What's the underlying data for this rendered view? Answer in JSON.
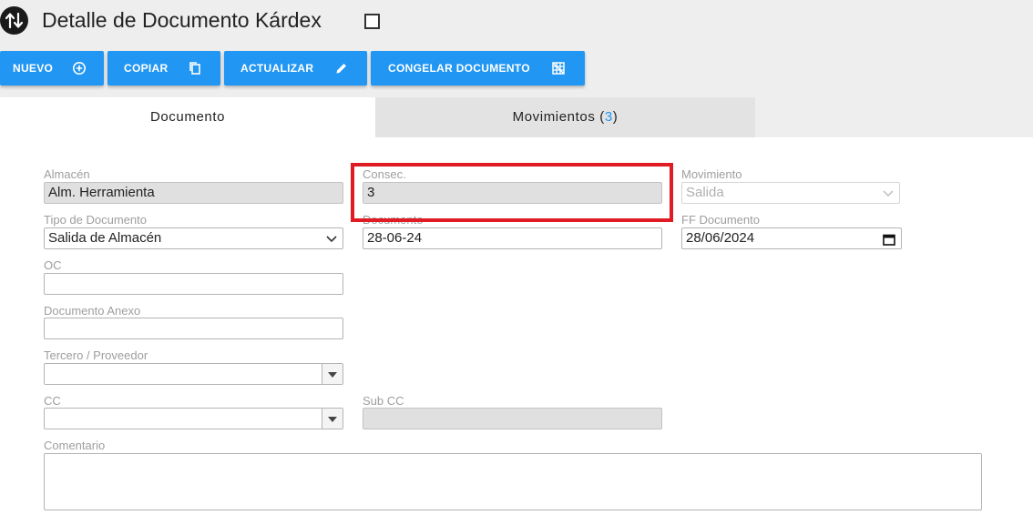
{
  "header": {
    "title": "Detalle de Documento Kárdex",
    "app_icon": "up-down-arrows-icon",
    "title_checkbox_checked": false
  },
  "toolbar": {
    "buttons": [
      {
        "label": "NUEVO",
        "icon": "plus-circle-icon"
      },
      {
        "label": "COPIAR",
        "icon": "copy-icon"
      },
      {
        "label": "ACTUALIZAR",
        "icon": "pencil-icon"
      },
      {
        "label": "CONGELAR DOCUMENTO",
        "icon": "freeze-grid-icon"
      }
    ]
  },
  "tabs": {
    "documento": {
      "label": "Documento",
      "active": true
    },
    "movimientos": {
      "label": "Movimientos",
      "count": "3",
      "open": "(",
      "close": ")",
      "active": false
    }
  },
  "form": {
    "almacen": {
      "label": "Almacén",
      "value": "Alm. Herramienta"
    },
    "consec": {
      "label": "Consec.",
      "value": "3"
    },
    "movimiento": {
      "label": "Movimiento",
      "value": "Salida"
    },
    "tipo_documento": {
      "label": "Tipo de Documento",
      "value": "Salida de Almacén"
    },
    "documento": {
      "label": "Documento",
      "value": "28-06-24"
    },
    "ff_documento": {
      "label": "FF Documento",
      "value": "28/06/2024"
    },
    "oc": {
      "label": "OC",
      "value": ""
    },
    "documento_anexo": {
      "label": "Documento Anexo",
      "value": ""
    },
    "tercero": {
      "label": "Tercero / Proveedor",
      "value": ""
    },
    "cc": {
      "label": "CC",
      "value": ""
    },
    "sub_cc": {
      "label": "Sub CC",
      "value": ""
    },
    "comentario": {
      "label": "Comentario",
      "value": ""
    }
  },
  "colors": {
    "primary": "#2196f3",
    "highlight": "#e01b24",
    "label": "#9e9e9e",
    "readonly_bg": "#e0e0e0"
  }
}
